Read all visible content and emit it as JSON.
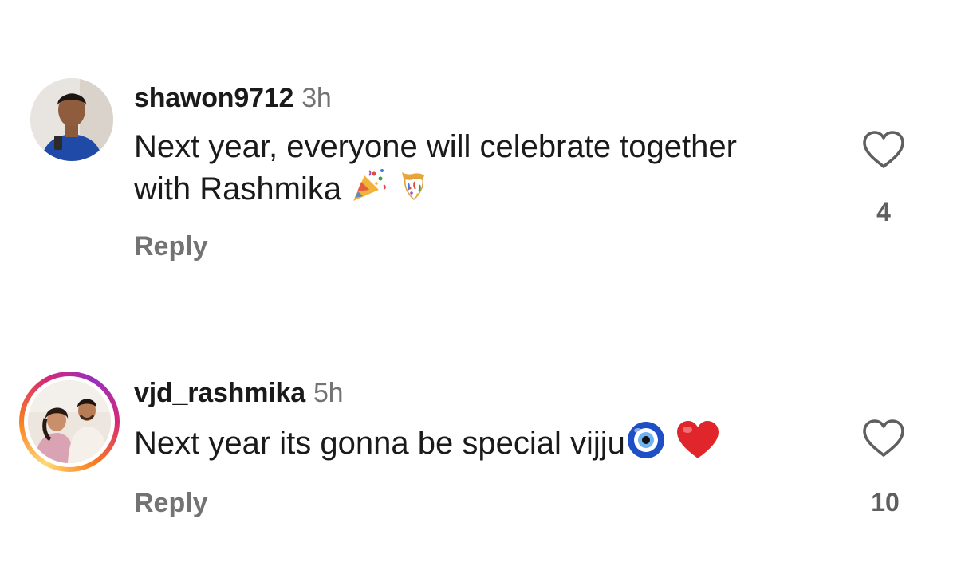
{
  "comments": [
    {
      "username": "shawon9712",
      "time": "3h",
      "text": "Next year, everyone will celebrate together with Rashmika",
      "emojis": [
        "party-popper-icon",
        "confetti-ball-icon"
      ],
      "reply_label": "Reply",
      "like_count": "4"
    },
    {
      "username": "vjd_rashmika",
      "time": "5h",
      "text": "Next year its gonna be special vijju",
      "emojis": [
        "nazar-amulet-icon",
        "red-heart-icon"
      ],
      "reply_label": "Reply",
      "like_count": "10",
      "has_story_ring": true
    }
  ],
  "colors": {
    "text": "#1a1a1a",
    "muted": "#737373",
    "story_ring": [
      "#feda75",
      "#fa7e1e",
      "#d62976",
      "#962fbf"
    ]
  }
}
